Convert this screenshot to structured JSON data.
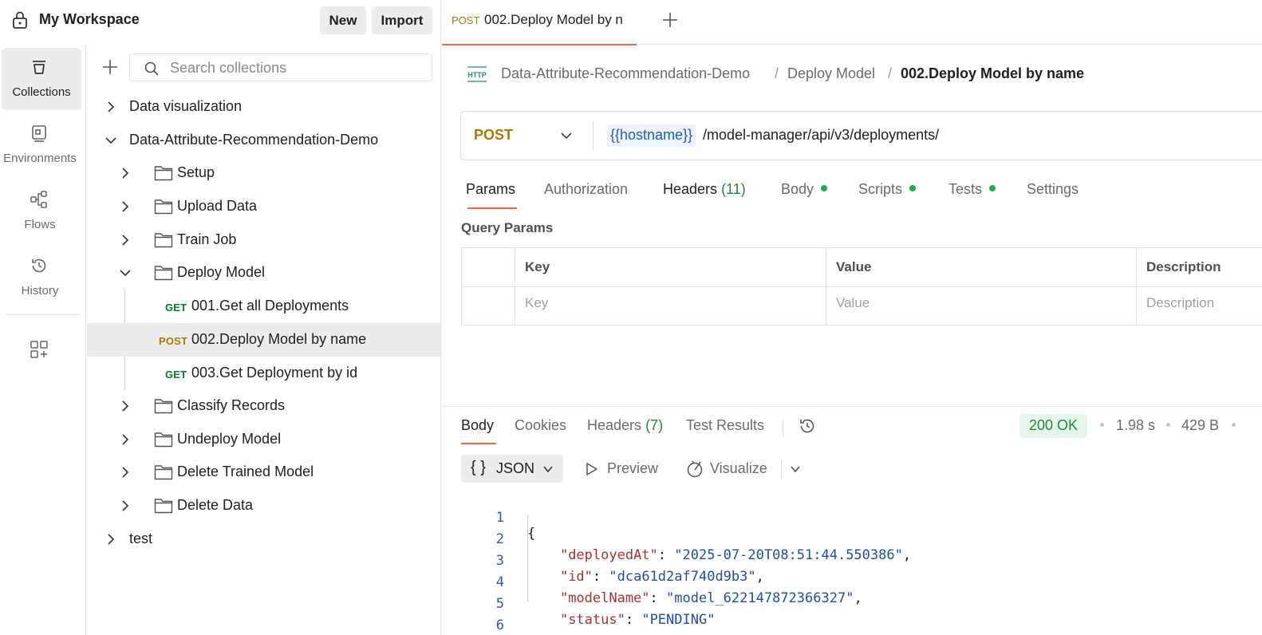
{
  "workspace": {
    "title": "My Workspace",
    "new_label": "New",
    "import_label": "Import"
  },
  "rail": {
    "items": [
      {
        "label": "Collections",
        "icon": "collections-icon",
        "active": true
      },
      {
        "label": "Environments",
        "icon": "environments-icon"
      },
      {
        "label": "Flows",
        "icon": "flows-icon"
      },
      {
        "label": "History",
        "icon": "history-icon"
      }
    ]
  },
  "search": {
    "placeholder": "Search collections"
  },
  "tree": [
    {
      "label": "Data visualization"
    },
    {
      "label": "Data-Attribute-Recommendation-Demo"
    },
    {
      "label": "Setup"
    },
    {
      "label": "Upload Data"
    },
    {
      "label": "Train Job"
    },
    {
      "label": "Deploy Model"
    },
    {
      "label": "001.Get all Deployments",
      "method": "GET"
    },
    {
      "label": "002.Deploy Model by name",
      "method": "POST"
    },
    {
      "label": "003.Get Deployment by id",
      "method": "GET"
    },
    {
      "label": "Classify Records"
    },
    {
      "label": "Undeploy Model"
    },
    {
      "label": "Delete Trained Model"
    },
    {
      "label": "Delete Data"
    },
    {
      "label": "test"
    }
  ],
  "tab": {
    "method": "POST",
    "title": "002.Deploy Model by n"
  },
  "breadcrumb": {
    "collection": "Data-Attribute-Recommendation-Demo",
    "folder": "Deploy Model",
    "request": "002.Deploy Model by name",
    "sep": "/"
  },
  "request": {
    "method": "POST",
    "url_variable": "{{hostname}}",
    "url_path": "/model-manager/api/v3/deployments/"
  },
  "request_tabs": {
    "params": "Params",
    "authorization": "Authorization",
    "headers": "Headers",
    "headers_count": "(11)",
    "body": "Body",
    "scripts": "Scripts",
    "tests": "Tests",
    "settings": "Settings"
  },
  "query_params": {
    "title": "Query Params",
    "headers": {
      "key": "Key",
      "value": "Value",
      "description": "Description"
    },
    "placeholders": {
      "key": "Key",
      "value": "Value",
      "description": "Description"
    }
  },
  "response": {
    "tabs": {
      "body": "Body",
      "cookies": "Cookies",
      "headers": "Headers",
      "headers_count": "(7)",
      "test_results": "Test Results"
    },
    "status": "200 OK",
    "time": "1.98 s",
    "size": "429 B",
    "format": "JSON",
    "format_braces": "{ }",
    "preview": "Preview",
    "visualize": "Visualize",
    "lines": [
      {
        "n": "1",
        "pre": "{",
        "key": "",
        "mid": "",
        "val": "",
        "post": ""
      },
      {
        "n": "2",
        "pre": "    ",
        "key": "\"deployedAt\"",
        "mid": ": ",
        "val": "\"2025-07-20T08:51:44.550386\"",
        "post": ","
      },
      {
        "n": "3",
        "pre": "    ",
        "key": "\"id\"",
        "mid": ": ",
        "val": "\"dca61d2af740d9b3\"",
        "post": ","
      },
      {
        "n": "4",
        "pre": "    ",
        "key": "\"modelName\"",
        "mid": ": ",
        "val": "\"model_622147872366327\"",
        "post": ","
      },
      {
        "n": "5",
        "pre": "    ",
        "key": "\"status\"",
        "mid": ": ",
        "val": "\"PENDING\"",
        "post": ""
      },
      {
        "n": "6",
        "pre": "}",
        "key": "",
        "mid": "",
        "val": "",
        "post": ""
      }
    ]
  },
  "colors": {
    "accent": "#f26b3a",
    "get": "#007f31",
    "post": "#ab7a00",
    "status_ok": "#1e8a3a",
    "variable": "#1d5bbf"
  }
}
